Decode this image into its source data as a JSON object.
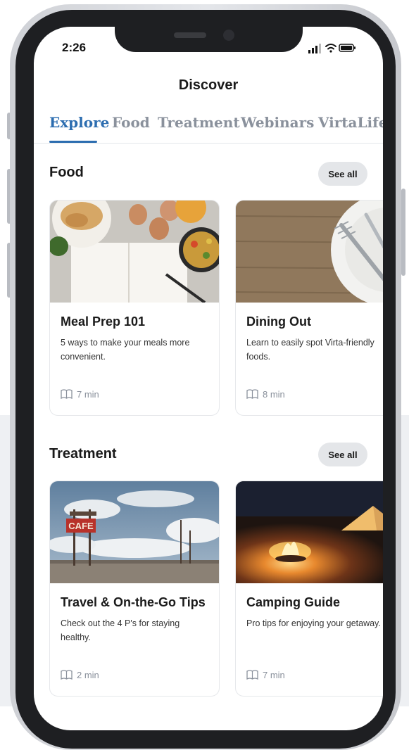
{
  "status_bar": {
    "time": "2:26",
    "icons": [
      "signal-icon",
      "wifi-icon",
      "battery-icon"
    ]
  },
  "header": {
    "title": "Discover"
  },
  "tabs": [
    {
      "label": "Explore",
      "active": true
    },
    {
      "label": "Food",
      "active": false
    },
    {
      "label": "Treatment",
      "active": false
    },
    {
      "label": "Webinars",
      "active": false
    },
    {
      "label": "VirtaLife",
      "active": false
    }
  ],
  "sections": {
    "food": {
      "title": "Food",
      "see_all": "See all",
      "cards": [
        {
          "title": "Meal Prep 101",
          "description": "5 ways to make your meals more convenient.",
          "duration": "7 min",
          "icon": "book-icon"
        },
        {
          "title": "Dining Out",
          "description": "Learn to easily spot Virta-friendly foods.",
          "duration": "8 min",
          "icon": "book-icon"
        }
      ]
    },
    "treatment": {
      "title": "Treatment",
      "see_all": "See all",
      "cards": [
        {
          "title": "Travel & On-the-Go Tips",
          "description": "Check out the 4 P's for staying healthy.",
          "duration": "2 min",
          "icon": "book-icon"
        },
        {
          "title": "Camping Guide",
          "description": "Pro tips for enjoying your getaway.",
          "duration": "7 min",
          "icon": "book-icon"
        }
      ]
    }
  },
  "images": {
    "cafe_sign": "CAFE"
  },
  "colors": {
    "accent": "#2c6db0",
    "tab_inactive": "#8a919c",
    "pill_bg": "#e4e6e9"
  }
}
